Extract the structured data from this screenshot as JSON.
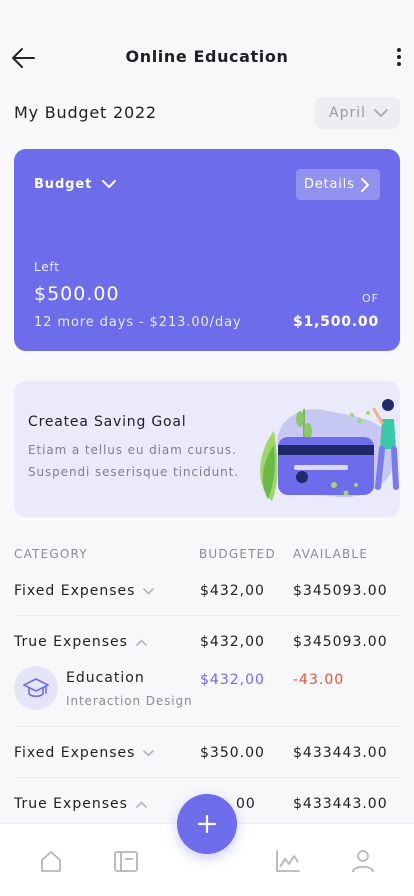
{
  "header": {
    "title": "Online Education"
  },
  "budget_header": {
    "title": "My Budget 2022",
    "month": "April"
  },
  "budget_card": {
    "selector": "Budget",
    "details": "Details",
    "left_label": "Left",
    "left_amount": "$500.00",
    "per_day": "12 more days - $213.00/day",
    "of_label": "OF",
    "total": "$1,500.00"
  },
  "goal_card": {
    "title": "Createa Saving Goal",
    "line1": "Etiam a tellus eu diam cursus.",
    "line2": "Suspendi seserisque tincidunt."
  },
  "table": {
    "headers": {
      "category": "CATEGORY",
      "budgeted": "BUDGETED",
      "available": "AVAILABLE"
    },
    "rows": [
      {
        "category": "Fixed Expenses",
        "budgeted": "$432,00",
        "available": "$345093.00"
      },
      {
        "category": "True Expenses",
        "budgeted": "$432,00",
        "available": "$345093.00"
      },
      {
        "category": "Fixed Expenses",
        "budgeted": "$350.00",
        "available": "$433443.00"
      },
      {
        "category": "True Expenses",
        "budgeted": "00",
        "available": "$433443.00"
      }
    ],
    "sub_item": {
      "name": "Education",
      "description": "Interaction Design",
      "budgeted": "$432,00",
      "available": "-43.00"
    }
  },
  "colors": {
    "accent": "#6D6CEB",
    "negative": "#E0543A",
    "background": "#F8F7FA"
  },
  "nav_icons": [
    "home-icon",
    "wallet-icon",
    "add-icon",
    "chart-icon",
    "profile-icon"
  ]
}
